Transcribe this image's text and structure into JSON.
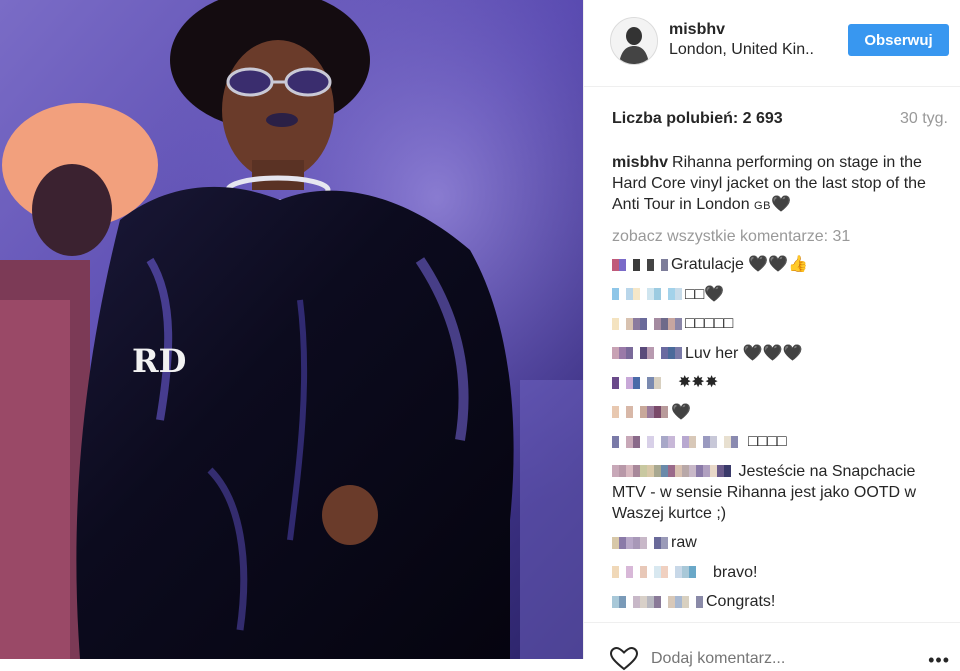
{
  "photo": {
    "alt_icon": "photo-of-performer"
  },
  "header": {
    "username": "misbhv",
    "location": "London, United Kin..",
    "follow_label": "Obserwuj"
  },
  "stats": {
    "likes": "Liczba polubień: 2 693",
    "time": "30 tyg."
  },
  "caption": {
    "user": "misbhv",
    "text": "Rihanna performing on stage in the Hard Core vinyl jacket on the last stop of the Anti Tour in London ",
    "flag": "GB",
    "emoji": "🖤"
  },
  "view_all": "zobacz wszystkie komentarze: 31",
  "comments": [
    {
      "text": "Gratulacje 🖤🖤👍"
    },
    {
      "text": "□□🖤"
    },
    {
      "text": "□□□□□"
    },
    {
      "text": "Luv her 🖤🖤🖤"
    },
    {
      "text": "✸✸✸"
    },
    {
      "text": "🖤"
    },
    {
      "text": "□□□□"
    },
    {
      "text": "Jesteście na Snapchacie MTV - w sensie Rihanna jest jako OOTD w Waszej kurtce ;)"
    },
    {
      "text": "raw"
    },
    {
      "text": "bravo!"
    },
    {
      "text": "Congrats!"
    }
  ],
  "add_comment": {
    "placeholder": "Dodaj komentarz..."
  },
  "more": "•••",
  "colors": {
    "accent": "#3897f0",
    "muted": "#999999"
  }
}
